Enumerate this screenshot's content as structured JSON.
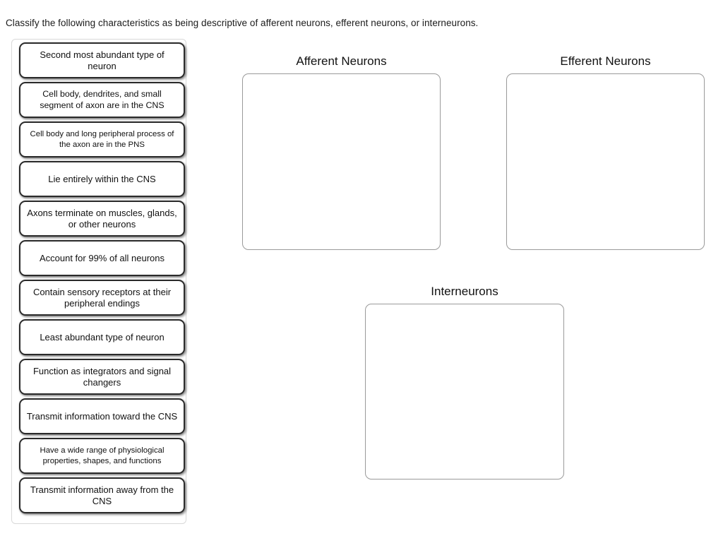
{
  "instruction": "Classify the following characteristics as being descriptive of afferent neurons, efferent neurons, or interneurons.",
  "colors": {
    "card_border": "#2a2a2a",
    "card_background": "#ffffff",
    "zone_border": "#9a9a9a",
    "bank_border": "#d9d9d9",
    "text": "#111111",
    "page_background": "#ffffff"
  },
  "card_bank": {
    "name": "characteristics-bank",
    "cards": [
      {
        "id": 1,
        "text": "Second most abundant type of neuron",
        "size": "lg"
      },
      {
        "id": 2,
        "text": "Cell body, dendrites, and small segment of axon are in the CNS",
        "size": "md"
      },
      {
        "id": 3,
        "text": "Cell body and long peripheral process of the axon are in the PNS",
        "size": "sm"
      },
      {
        "id": 4,
        "text": "Lie entirely within the CNS",
        "size": "lg"
      },
      {
        "id": 5,
        "text": "Axons terminate on muscles, glands, or other neurons",
        "size": "lg"
      },
      {
        "id": 6,
        "text": "Account for 99% of all neurons",
        "size": "lg"
      },
      {
        "id": 7,
        "text": "Contain sensory receptors at their peripheral endings",
        "size": "lg"
      },
      {
        "id": 8,
        "text": "Least abundant type of neuron",
        "size": "lg"
      },
      {
        "id": 9,
        "text": "Function as integrators and signal changers",
        "size": "lg"
      },
      {
        "id": 10,
        "text": "Transmit information toward the CNS",
        "size": "lg"
      },
      {
        "id": 11,
        "text": "Have a wide range of physiological properties, shapes, and functions",
        "size": "sm"
      },
      {
        "id": 12,
        "text": "Transmit information away from the CNS",
        "size": "lg"
      }
    ]
  },
  "drop_zones": [
    {
      "id": "afferent",
      "title": "Afferent Neurons",
      "items": []
    },
    {
      "id": "efferent",
      "title": "Efferent Neurons",
      "items": []
    },
    {
      "id": "interneuron",
      "title": "Interneurons",
      "items": []
    }
  ]
}
